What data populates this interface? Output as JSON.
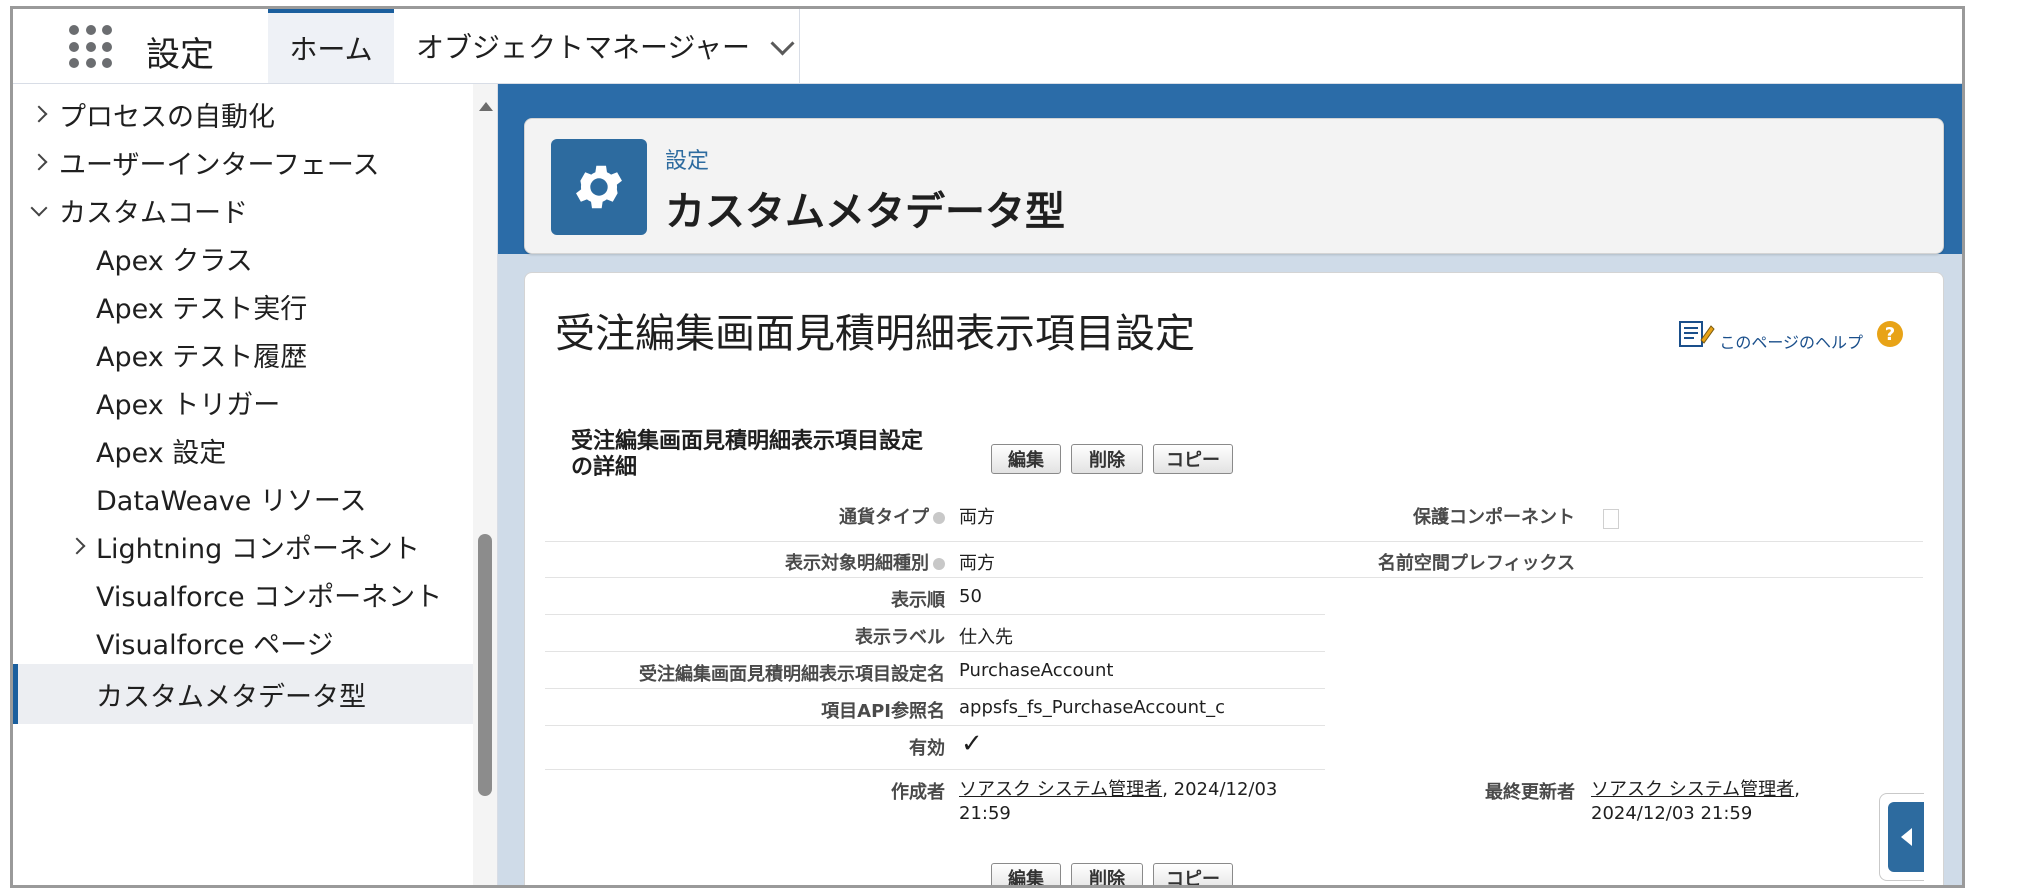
{
  "header": {
    "app_title": "設定",
    "tabs": [
      {
        "label": "ホーム"
      },
      {
        "label": "オブジェクトマネージャー"
      }
    ]
  },
  "sidebar": {
    "items": [
      {
        "label": "プロセスの自動化"
      },
      {
        "label": "ユーザーインターフェース"
      },
      {
        "label": "カスタムコード"
      },
      {
        "label": "Apex クラス"
      },
      {
        "label": "Apex テスト実行"
      },
      {
        "label": "Apex テスト履歴"
      },
      {
        "label": "Apex トリガー"
      },
      {
        "label": "Apex 設定"
      },
      {
        "label": "DataWeave リソース"
      },
      {
        "label": "Lightning コンポーネント"
      },
      {
        "label": "Visualforce コンポーネント"
      },
      {
        "label": "Visualforce ページ"
      },
      {
        "label": "カスタムメタデータ型"
      }
    ]
  },
  "page_header": {
    "breadcrumb": "設定",
    "title": "カスタムメタデータ型"
  },
  "record": {
    "title": "受注編集画面見積明細表示項目設定",
    "help_text": "このページのヘルプ",
    "help_q": "?",
    "detail_title": "受注編集画面見積明細表示項目設定の詳細",
    "buttons": {
      "edit": "編集",
      "delete": "削除",
      "copy": "コピー"
    },
    "fields": {
      "currency_type_label": "通貨タイプ",
      "currency_type_value": "両方",
      "protected_label": "保護コンポーネント",
      "target_kind_label": "表示対象明細種別",
      "target_kind_value": "両方",
      "namespace_label": "名前空間プレフィックス",
      "order_label": "表示順",
      "order_value": "50",
      "display_label_label": "表示ラベル",
      "display_label_value": "仕入先",
      "setting_name_label": "受注編集画面見積明細表示項目設定名",
      "setting_name_value": "PurchaseAccount",
      "api_ref_label": "項目API参照名",
      "api_ref_value": "appsfs_fs_PurchaseAccount_c",
      "active_label": "有効",
      "active_value": "✓",
      "created_by_label": "作成者",
      "created_by_user": "ソアスク システム管理者",
      "created_by_date": ", 2024/12/03",
      "created_by_time": "21:59",
      "modified_by_label": "最終更新者",
      "modified_by_user": "ソアスク システム管理者",
      "modified_by_sep": ",",
      "modified_by_datetime": "2024/12/03 21:59"
    }
  },
  "colors": {
    "brand_blue": "#2d6b9f",
    "accent_blue": "#1b5f9e",
    "help_orange": "#e8a317"
  }
}
